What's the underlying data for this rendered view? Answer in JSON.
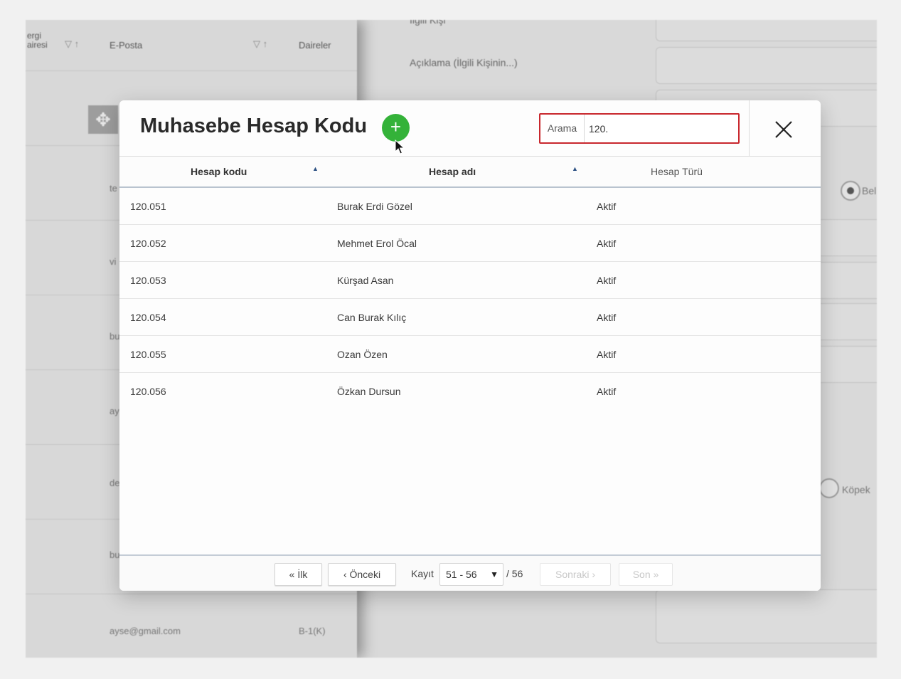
{
  "background": {
    "table_headers": {
      "vergi_dairesi": "ergi\nairesi",
      "email": "E-Posta",
      "daireler": "Daireler"
    },
    "row_labels": [
      "te",
      "vi",
      "bu",
      "ay",
      "de",
      "bu"
    ],
    "last_row": {
      "email": "ayse@gmail.com",
      "daire": "B-1(K)"
    },
    "form_labels": {
      "ilgili_kisi": "İlgili Kişi",
      "aciklama": "Açıklama (İlgili Kişinin...)"
    },
    "radio_labels": {
      "bel": "Bel",
      "kopek": "Köpek"
    }
  },
  "modal": {
    "title": "Muhasebe Hesap Kodu",
    "add_button": "+",
    "search": {
      "label": "Arama",
      "value": "120."
    },
    "columns": {
      "code": "Hesap kodu",
      "name": "Hesap adı",
      "type": "Hesap Türü"
    },
    "rows": [
      {
        "code": "120.051",
        "name": "Burak Erdi Gözel",
        "type": "Aktif"
      },
      {
        "code": "120.052",
        "name": "Mehmet Erol Öcal",
        "type": "Aktif"
      },
      {
        "code": "120.053",
        "name": "Kürşad Asan",
        "type": "Aktif"
      },
      {
        "code": "120.054",
        "name": "Can Burak Kılıç",
        "type": "Aktif"
      },
      {
        "code": "120.055",
        "name": "Ozan Özen",
        "type": "Aktif"
      },
      {
        "code": "120.056",
        "name": "Özkan Dursun",
        "type": "Aktif"
      }
    ],
    "pagination": {
      "first": "« İlk",
      "prev": "‹ Önceki",
      "record_label": "Kayıt",
      "range": "51 - 56",
      "total": "/ 56",
      "next": "Sonraki ›",
      "last": "Son »"
    }
  },
  "colors": {
    "accent_green": "#34b239",
    "search_border": "#c8272d",
    "header_border": "#b9c3cf"
  }
}
